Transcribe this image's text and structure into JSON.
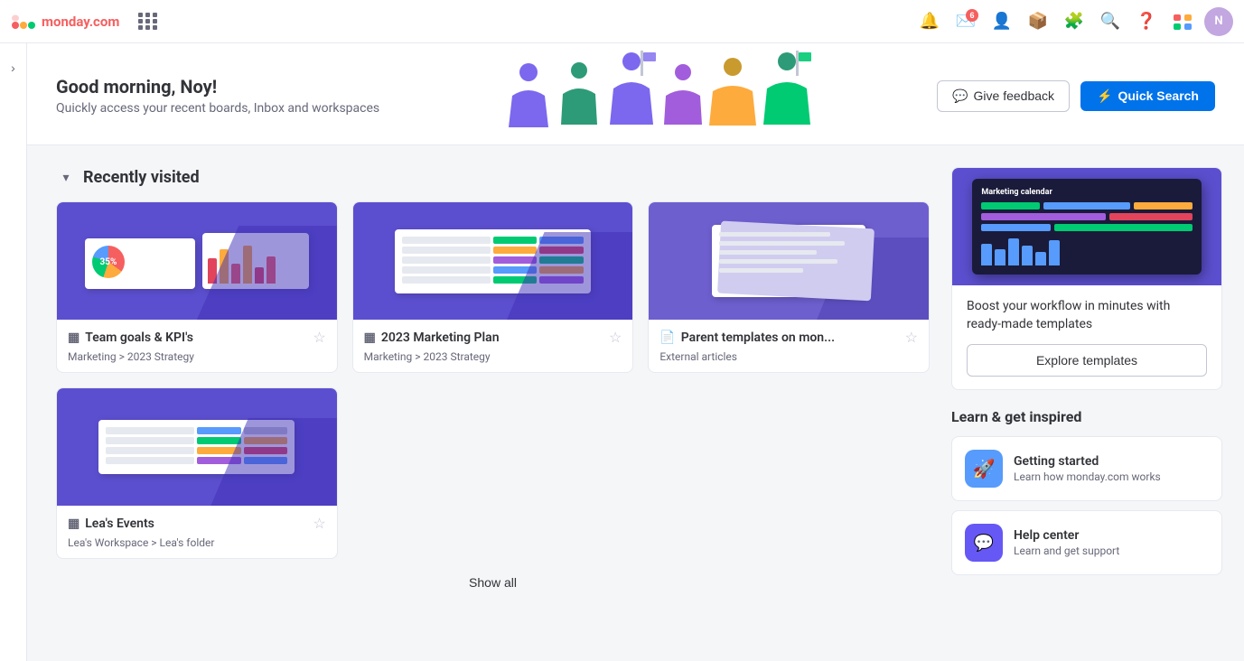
{
  "app": {
    "name": "monday",
    "domain": ".com"
  },
  "topnav": {
    "logo_text": "monday",
    "logo_domain": ".com",
    "badge_count": "6",
    "icons": [
      "apps-grid",
      "notifications",
      "inbox",
      "add-user",
      "install",
      "apps-marketplace",
      "search",
      "help",
      "brand"
    ]
  },
  "header": {
    "greeting": "Good morning, Noy!",
    "subtitle": "Quickly access your recent boards, Inbox and workspaces",
    "btn_feedback": "Give feedback",
    "btn_quicksearch": "Quick Search"
  },
  "recently_visited": {
    "title": "Recently visited",
    "cards": [
      {
        "title": "Team goals & KPI's",
        "icon": "board-icon",
        "path": "Marketing > 2023 Strategy",
        "type": "board"
      },
      {
        "title": "2023 Marketing Plan",
        "icon": "board-icon",
        "path": "Marketing > 2023 Strategy",
        "type": "board"
      },
      {
        "title": "Parent templates on mon...",
        "icon": "doc-icon",
        "path": "External articles",
        "type": "doc"
      },
      {
        "title": "Lea's Events",
        "icon": "board-icon",
        "path": "Lea's Workspace > Lea's folder",
        "type": "board"
      }
    ],
    "show_all": "Show all"
  },
  "template_section": {
    "headline": "Boost your workflow in minutes with ready-made templates",
    "btn_label": "Explore templates"
  },
  "learn_section": {
    "title": "Learn & get inspired",
    "items": [
      {
        "title": "Getting started",
        "subtitle": "Learn how monday.com works",
        "icon_type": "rocket"
      },
      {
        "title": "Help center",
        "subtitle": "Learn and get support",
        "icon_type": "help"
      }
    ]
  }
}
